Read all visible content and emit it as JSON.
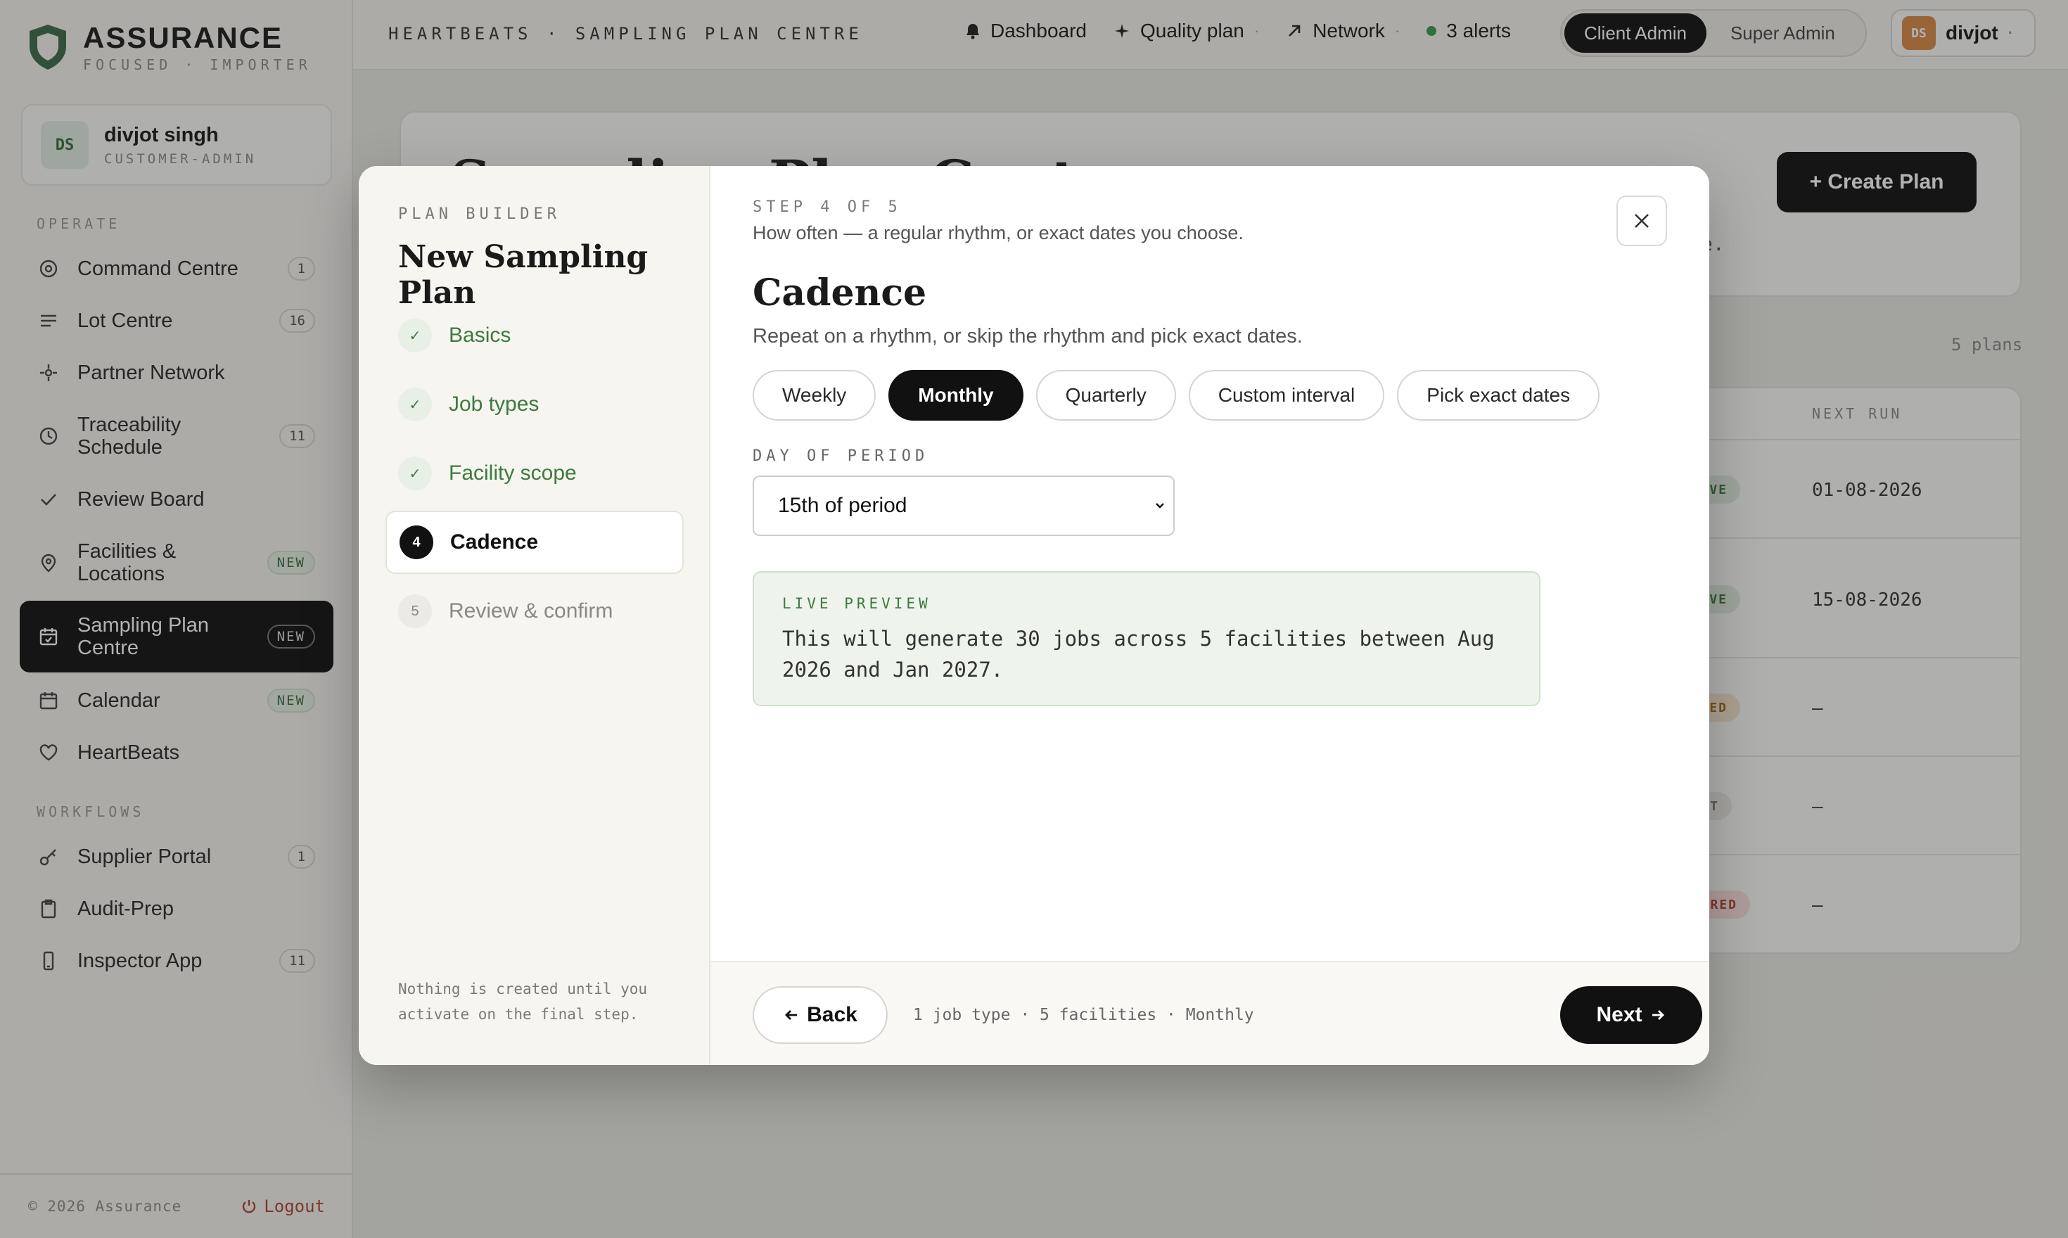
{
  "brand": {
    "name": "ASSURANCE",
    "subtitle": "FOCUSED · IMPORTER"
  },
  "user": {
    "initials": "DS",
    "name": "divjot singh",
    "role": "CUSTOMER-ADMIN"
  },
  "sidebar": {
    "operate_label": "OPERATE",
    "workflows_label": "WORKFLOWS",
    "items": [
      {
        "label": "Command Centre",
        "badge": "1",
        "icon": "target-icon"
      },
      {
        "label": "Lot Centre",
        "badge": "16",
        "icon": "list-icon"
      },
      {
        "label": "Partner Network",
        "badge": "",
        "icon": "network-icon"
      },
      {
        "label": "Traceability Schedule",
        "badge": "11",
        "icon": "clock-icon"
      },
      {
        "label": "Review Board",
        "badge": "",
        "icon": "check-icon"
      },
      {
        "label": "Facilities & Locations",
        "badge": "NEW",
        "icon": "pin-icon"
      },
      {
        "label": "Sampling Plan Centre",
        "badge": "NEW",
        "icon": "calendar-check-icon"
      },
      {
        "label": "Calendar",
        "badge": "NEW",
        "icon": "calendar-icon"
      },
      {
        "label": "HeartBeats",
        "badge": "",
        "icon": "heart-icon"
      }
    ],
    "workflow_items": [
      {
        "label": "Supplier Portal",
        "badge": "1",
        "icon": "key-icon"
      },
      {
        "label": "Audit-Prep",
        "badge": "",
        "icon": "clipboard-icon"
      },
      {
        "label": "Inspector App",
        "badge": "11",
        "icon": "phone-icon"
      }
    ],
    "copyright": "© 2026 Assurance",
    "logout": "Logout"
  },
  "topbar": {
    "breadcrumb": "HEARTBEATS · SAMPLING PLAN CENTRE",
    "links": {
      "dashboard": "Dashboard",
      "quality_plan": "Quality plan",
      "network": "Network",
      "alerts": "3 alerts"
    },
    "roles": {
      "client_admin": "Client Admin",
      "super_admin": "Super Admin"
    },
    "user_initials": "DS",
    "user_name": "divjot"
  },
  "background": {
    "title": "Sampling Plan Centre",
    "create_button": "+ Create Plan",
    "fragment": "e.",
    "plans_count": "5 plans",
    "next_run_header": "NEXT RUN",
    "rows": [
      {
        "status": "VE",
        "next_run": "01-08-2026"
      },
      {
        "status": "VE",
        "next_run": "15-08-2026"
      },
      {
        "status": "ED",
        "next_run": "–"
      },
      {
        "status": "T",
        "next_run": "–"
      },
      {
        "status": "RED",
        "next_run": "–"
      }
    ]
  },
  "modal": {
    "eyebrow": "PLAN BUILDER",
    "title": "New Sampling Plan",
    "steps": [
      {
        "num": "✓",
        "label": "Basics"
      },
      {
        "num": "✓",
        "label": "Job types"
      },
      {
        "num": "✓",
        "label": "Facility scope"
      },
      {
        "num": "4",
        "label": "Cadence"
      },
      {
        "num": "5",
        "label": "Review & confirm"
      }
    ],
    "left_note": "Nothing is created until you activate on the final step.",
    "step_eyebrow": "STEP 4 OF 5",
    "step_subtitle": "How often — a regular rhythm, or exact dates you choose.",
    "section_title": "Cadence",
    "section_desc": "Repeat on a rhythm, or skip the rhythm and pick exact dates.",
    "options": [
      "Weekly",
      "Monthly",
      "Quarterly",
      "Custom interval",
      "Pick exact dates"
    ],
    "selected_option": "Monthly",
    "day_of_period_label": "DAY OF PERIOD",
    "day_of_period_value": "15th of period",
    "preview_label": "LIVE PREVIEW",
    "preview_text": "This will generate 30 jobs across 5 facilities between Aug 2026 and Jan 2027.",
    "back_label": "Back",
    "summary": "1 job type · 5 facilities · Monthly",
    "next_label": "Next"
  },
  "colors": {
    "accent_green": "#3e7a3f",
    "dark": "#111111",
    "logout_red": "#b0442f",
    "avatar_orange": "#d68b45"
  }
}
